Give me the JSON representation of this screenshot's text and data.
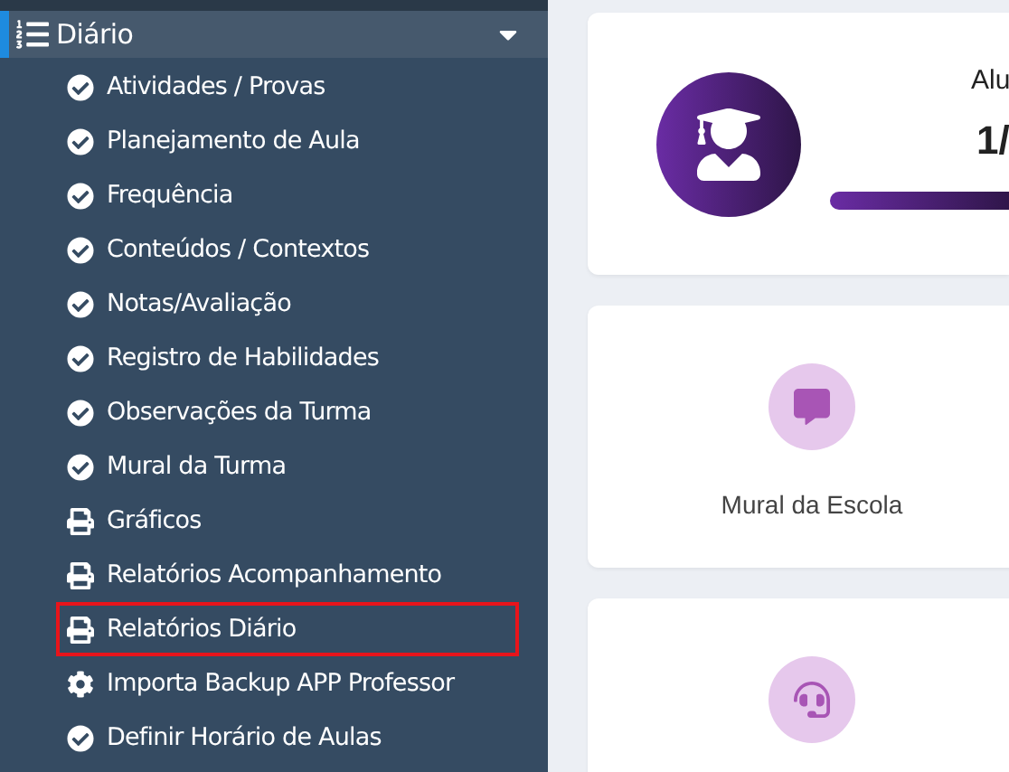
{
  "sidebar": {
    "section": {
      "label": "Diário",
      "expanded": true
    },
    "items": [
      {
        "kind": "check",
        "label": "Atividades / Provas",
        "highlighted": false
      },
      {
        "kind": "check",
        "label": "Planejamento de Aula",
        "highlighted": false
      },
      {
        "kind": "check",
        "label": "Frequência",
        "highlighted": false
      },
      {
        "kind": "check",
        "label": "Conteúdos / Contextos",
        "highlighted": false
      },
      {
        "kind": "check",
        "label": "Notas/Avaliação",
        "highlighted": false
      },
      {
        "kind": "check",
        "label": "Registro de Habilidades",
        "highlighted": false
      },
      {
        "kind": "check",
        "label": "Observações da Turma",
        "highlighted": false
      },
      {
        "kind": "check",
        "label": "Mural da Turma",
        "highlighted": false
      },
      {
        "kind": "print",
        "label": "Gráficos",
        "highlighted": false
      },
      {
        "kind": "print",
        "label": "Relatórios Acompanhamento",
        "highlighted": false
      },
      {
        "kind": "print",
        "label": "Relatórios Diário",
        "highlighted": true
      },
      {
        "kind": "gear",
        "label": "Importa Backup APP Professor",
        "highlighted": false
      },
      {
        "kind": "check",
        "label": "Definir Horário de Aulas",
        "highlighted": false
      }
    ]
  },
  "stat_card": {
    "title": "Alu",
    "value": "1/",
    "level": 1
  },
  "shortcuts": [
    {
      "kind": "chat",
      "label": "Mural da Escola"
    },
    {
      "kind": "headset"
    }
  ]
}
